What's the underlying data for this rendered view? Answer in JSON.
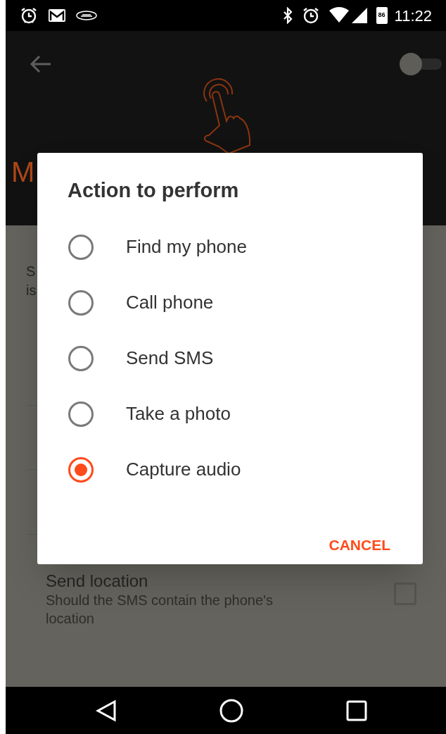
{
  "status_bar": {
    "battery": "86",
    "time": "11:22"
  },
  "header": {
    "toggle": {
      "on": false
    },
    "title": "M"
  },
  "content": {
    "description_lines": [
      "S",
      "is"
    ],
    "setting": {
      "title": "Send location",
      "description": "Should the SMS contain the phone's location",
      "checked": false
    }
  },
  "dialog": {
    "title": "Action to perform",
    "options": [
      {
        "label": "Find my phone",
        "selected": false
      },
      {
        "label": "Call phone",
        "selected": false
      },
      {
        "label": "Send SMS",
        "selected": false
      },
      {
        "label": "Take a photo",
        "selected": false
      },
      {
        "label": "Capture audio",
        "selected": true
      }
    ],
    "buttons": [
      "CANCEL"
    ]
  }
}
